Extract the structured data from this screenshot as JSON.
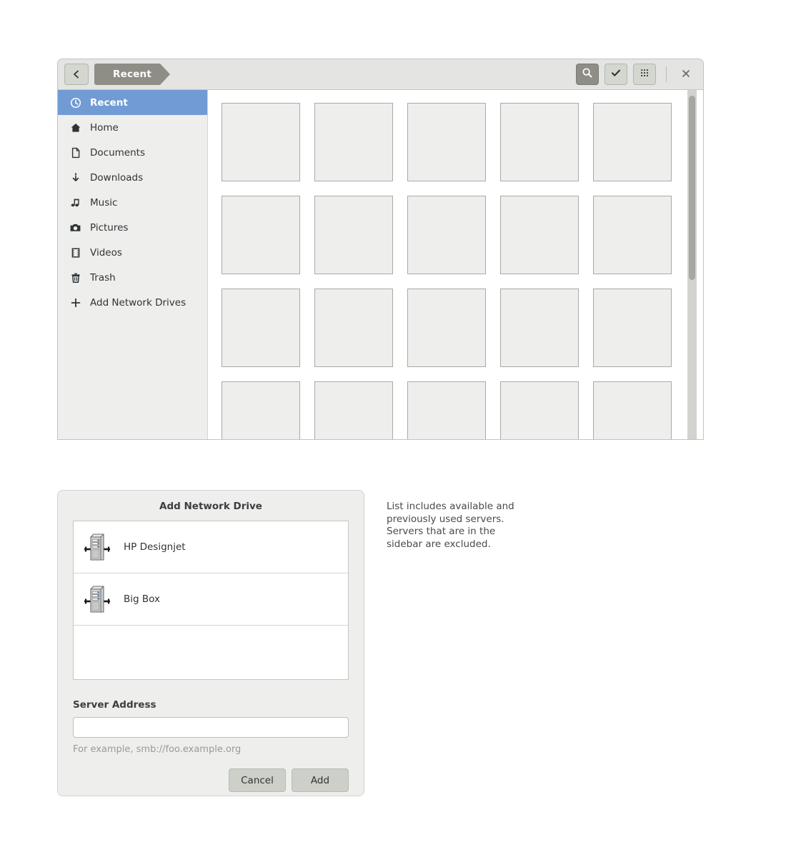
{
  "file_chooser": {
    "back_button": {
      "icon": "chevron-left-icon",
      "label": "Back"
    },
    "breadcrumb": {
      "label": "Recent"
    },
    "toolbar": [
      {
        "name": "search-button",
        "icon": "search-icon",
        "label": "Search",
        "active": true
      },
      {
        "name": "select-button",
        "icon": "check-icon",
        "label": "Select",
        "active": false
      },
      {
        "name": "view-grid-button",
        "icon": "grid-dots-icon",
        "label": "View options",
        "active": false
      }
    ],
    "close_button": {
      "icon": "close-icon",
      "label": "×"
    },
    "sidebar": {
      "items": [
        {
          "label": "Recent",
          "icon": "clock-icon",
          "selected": true
        },
        {
          "label": "Home",
          "icon": "home-icon",
          "selected": false
        },
        {
          "label": "Documents",
          "icon": "document-icon",
          "selected": false
        },
        {
          "label": "Downloads",
          "icon": "download-icon",
          "selected": false
        },
        {
          "label": "Music",
          "icon": "music-note-icon",
          "selected": false
        },
        {
          "label": "Pictures",
          "icon": "camera-icon",
          "selected": false
        },
        {
          "label": "Videos",
          "icon": "film-icon",
          "selected": false
        },
        {
          "label": "Trash",
          "icon": "trash-icon",
          "selected": false
        },
        {
          "label": "Add Network Drives",
          "icon": "plus-icon",
          "selected": false
        }
      ]
    },
    "grid": {
      "columns": 5,
      "rows": 4,
      "item_count": 20,
      "items": [
        "",
        "",
        "",
        "",
        "",
        "",
        "",
        "",
        "",
        "",
        "",
        "",
        "",
        "",
        "",
        "",
        "",
        "",
        "",
        ""
      ]
    },
    "scrollbar": {
      "orientation": "vertical",
      "thumb_position_pct": 2,
      "thumb_size_pct": 52
    }
  },
  "dialog": {
    "title": "Add Network Drive",
    "servers": [
      {
        "label": "HP Designjet",
        "icon": "server-icon"
      },
      {
        "label": "Big Box",
        "icon": "server-icon"
      }
    ],
    "field": {
      "label": "Server Address",
      "value": "",
      "placeholder": "",
      "hint": "For example, smb://foo.example.org"
    },
    "buttons": {
      "cancel": "Cancel",
      "add": "Add"
    }
  },
  "annotation": {
    "text": "List includes available and previously used servers. Servers that are in the sidebar are excluded."
  },
  "colors": {
    "selection_blue": "#719bd4",
    "breadcrumb_gray": "#8e8e87",
    "header_bg": "#e4e4e2",
    "sidebar_bg": "#eeeeec",
    "tile_fill": "#eeeeec",
    "button_face": "#ccd0c8"
  }
}
